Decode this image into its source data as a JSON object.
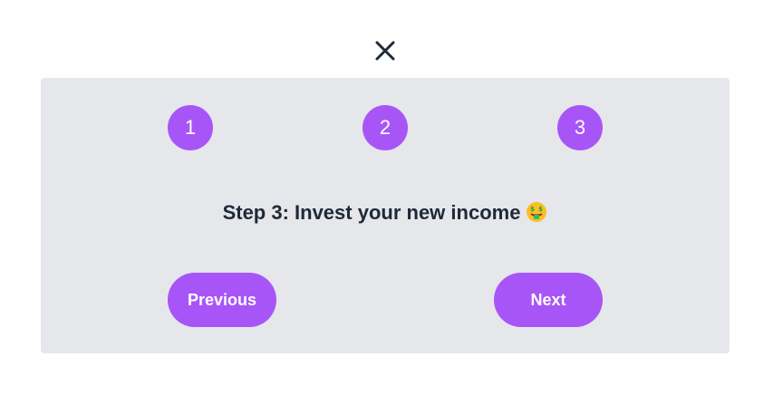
{
  "close": {
    "icon": "close-icon"
  },
  "steps": [
    {
      "label": "1"
    },
    {
      "label": "2"
    },
    {
      "label": "3"
    }
  ],
  "current_step": {
    "text": "Step 3: Invest your new income",
    "emoji_icon": "money-mouth-face-icon"
  },
  "buttons": {
    "previous": "Previous",
    "next": "Next"
  },
  "colors": {
    "accent": "#a855f7",
    "card_background": "#e5e7eb",
    "text": "#1f2937"
  }
}
